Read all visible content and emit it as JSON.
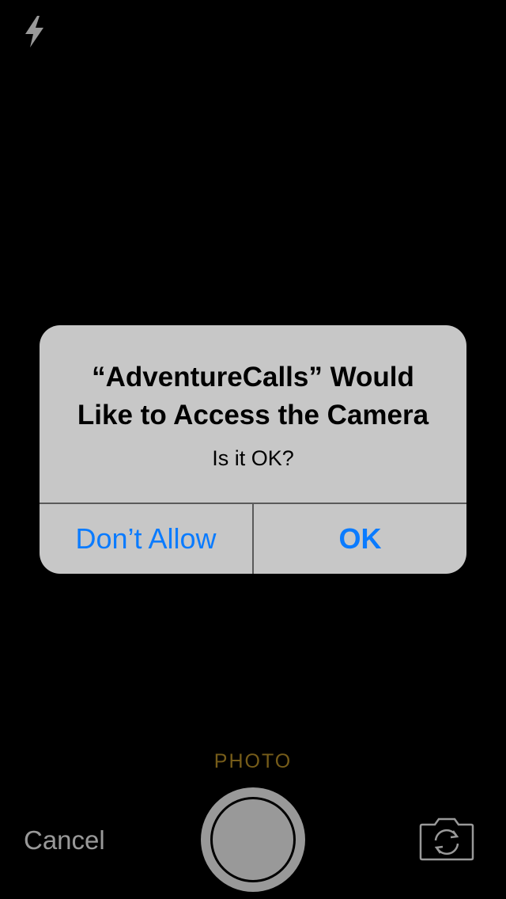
{
  "top_bar": {
    "flash_icon": "lightning-bolt-icon"
  },
  "alert": {
    "title": "“AdventureCalls” Would\nLike to Access the Camera",
    "message": "Is it OK?",
    "buttons": {
      "deny_label": "Don’t Allow",
      "allow_label": "OK"
    },
    "button_color": "#0a7bff"
  },
  "camera_controls": {
    "mode_label": "PHOTO",
    "mode_color": "#c59a2b",
    "cancel_label": "Cancel",
    "shutter_icon": "shutter-button-icon",
    "switch_camera_icon": "camera-switch-icon"
  }
}
